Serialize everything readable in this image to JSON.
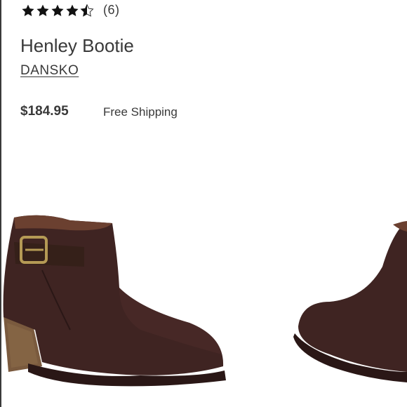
{
  "product": {
    "rating": {
      "value": 4.5,
      "max": 5,
      "count_label": "(6)"
    },
    "title": "Henley Bootie",
    "brand": "DANSKO",
    "price": "$184.95",
    "shipping": "Free Shipping"
  },
  "colors": {
    "text": "#393939",
    "star": "#111111",
    "boot_leather": "#3f2422",
    "heel_wood": "#7a5a3e",
    "buckle": "#b59a55"
  },
  "icons": {
    "star": "star-icon",
    "half_star": "half-star-icon"
  }
}
